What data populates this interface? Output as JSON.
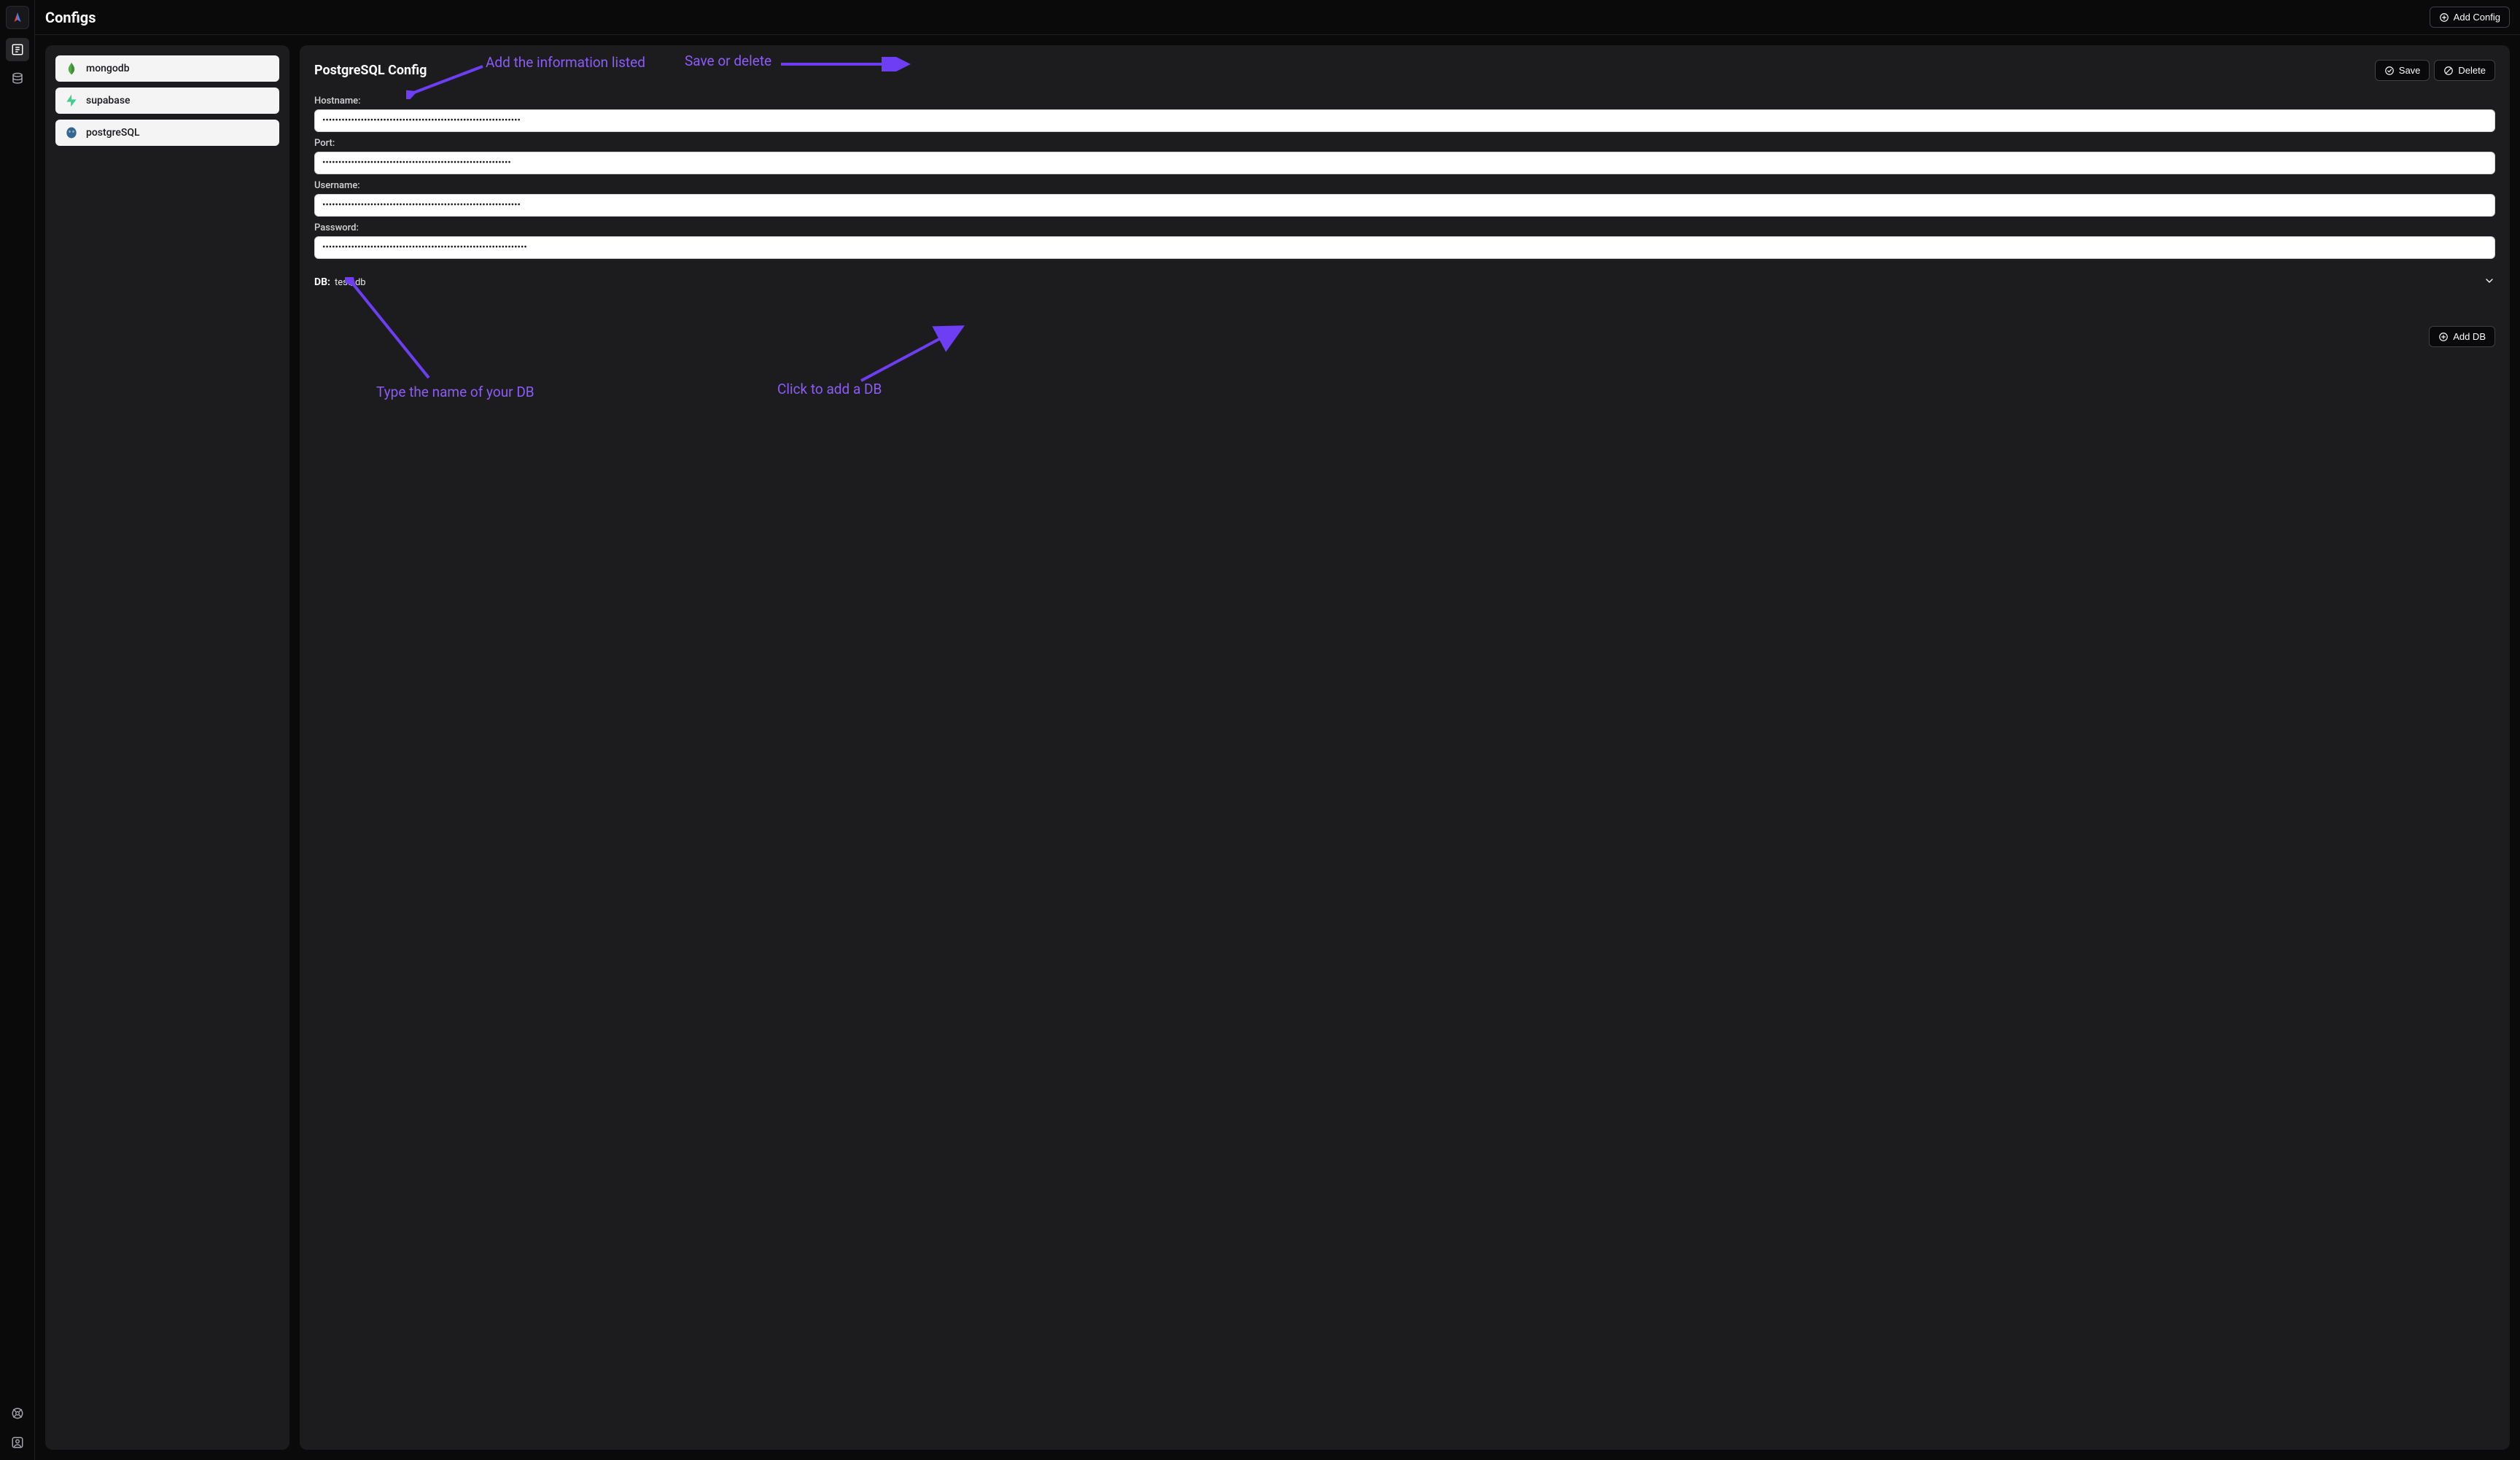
{
  "topbar": {
    "title": "Configs",
    "add_config_label": "Add Config"
  },
  "sidebar": {
    "items": [
      {
        "label": "mongodb",
        "icon": "mongodb-icon"
      },
      {
        "label": "supabase",
        "icon": "supabase-icon"
      },
      {
        "label": "postgreSQL",
        "icon": "postgresql-icon"
      }
    ]
  },
  "detail": {
    "title": "PostgreSQL Config",
    "save_label": "Save",
    "delete_label": "Delete",
    "fields": {
      "hostname": {
        "label": "Hostname:",
        "value_masked": "••••••••••••••••••••••••••••••••••••••••••••••••••••••••••••••"
      },
      "port": {
        "label": "Port:",
        "value_masked": "•••••••••••••••••••••••••••••••••••••••••••••••••••••••••••"
      },
      "username": {
        "label": "Username:",
        "value_masked": "••••••••••••••••••••••••••••••••••••••••••••••••••••••••••••••"
      },
      "password": {
        "label": "Password:",
        "value_masked": "••••••••••••••••••••••••••••••••••••••••••••••••••••••••••••••••"
      }
    },
    "db_section": {
      "prefix": "DB:",
      "name": "test_db"
    },
    "add_db_label": "Add DB"
  },
  "annotations": {
    "info_text": "Add the information listed",
    "save_text": "Save or delete",
    "db_text": "Type the name of your DB",
    "add_db_text": "Click to add a DB"
  },
  "colors": {
    "accent_purple": "#8b5cf6",
    "bg": "#0a0a0a",
    "panel": "#1c1c1e"
  }
}
